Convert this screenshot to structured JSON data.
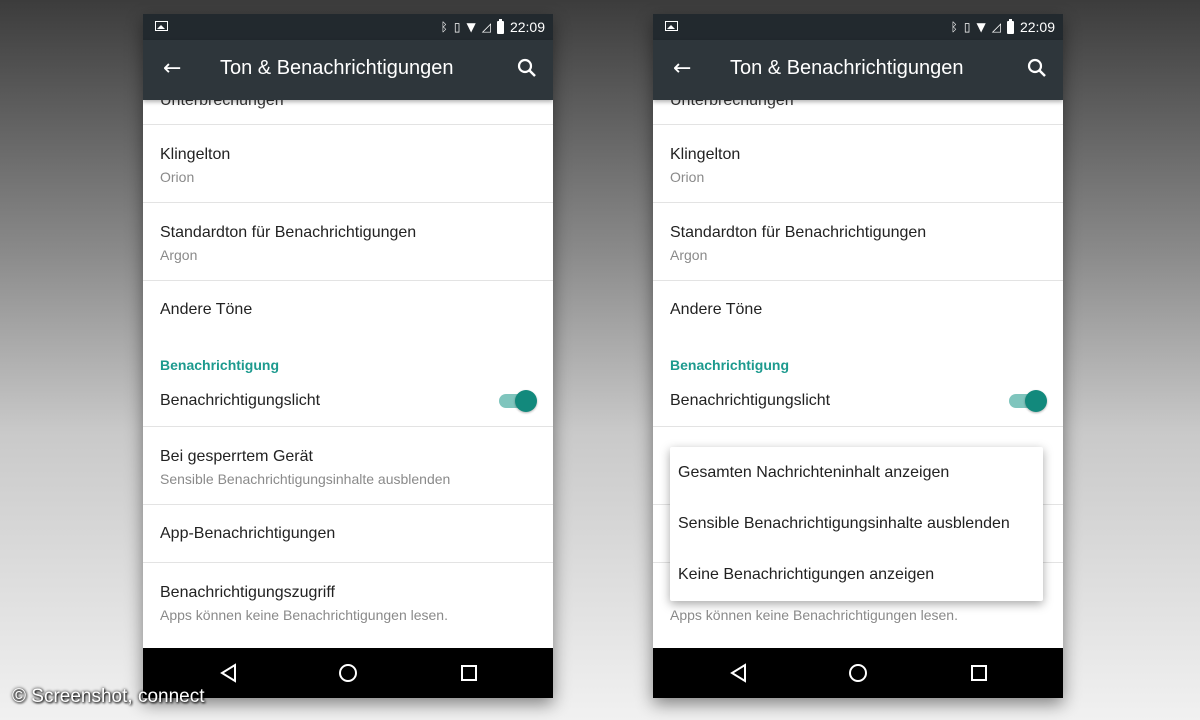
{
  "watermark": "© Screenshot, connect",
  "status_bar": {
    "time": "22:09"
  },
  "app_bar": {
    "title": "Ton & Benachrichtigungen"
  },
  "settings": {
    "partial_item": "Unterbrechungen",
    "ringtone": {
      "title": "Klingelton",
      "value": "Orion"
    },
    "default_tone": {
      "title": "Standardton für Benachrichtigungen",
      "value": "Argon"
    },
    "other_tones": {
      "title": "Andere Töne"
    },
    "section_header": "Benachrichtigung",
    "light": {
      "title": "Benachrichtigungslicht",
      "enabled": true
    },
    "locked": {
      "title": "Bei gesperrtem Gerät",
      "value": "Sensible Benachrichtigungsinhalte ausblenden"
    },
    "app_notifications": {
      "title": "App-Benachrichtigungen"
    },
    "access": {
      "title": "Benachrichtigungszugriff",
      "value": "Apps können keine Benachrichtigungen lesen."
    }
  },
  "popup": {
    "options": [
      "Gesamten Nachrichteninhalt anzeigen",
      "Sensible Benachrichtigungsinhalte ausblenden",
      "Keine Benachrichtigungen anzeigen"
    ]
  },
  "colors": {
    "accent": "#1c9a8e",
    "toolbar": "#2e363b",
    "statusbar": "#22292e"
  }
}
